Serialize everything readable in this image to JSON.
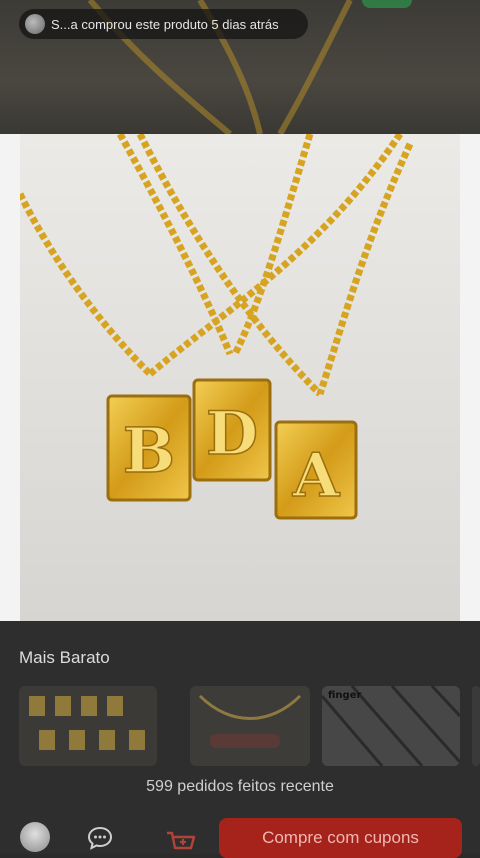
{
  "toast": {
    "text": "S...a comprou este produto 5 dias atrás"
  },
  "product": {
    "letters": [
      "B",
      "D",
      "A"
    ]
  },
  "recommendations": {
    "title": "Mais Barato",
    "thumbs": [
      {
        "label": ""
      },
      {
        "label": ""
      },
      {
        "label": "finger"
      }
    ]
  },
  "orders_text": "599 pedidos feitos recente",
  "bottom": {
    "buy_label": "Compre com cupons"
  },
  "colors": {
    "accent": "#a5231b",
    "gold": "#d4a21a"
  }
}
